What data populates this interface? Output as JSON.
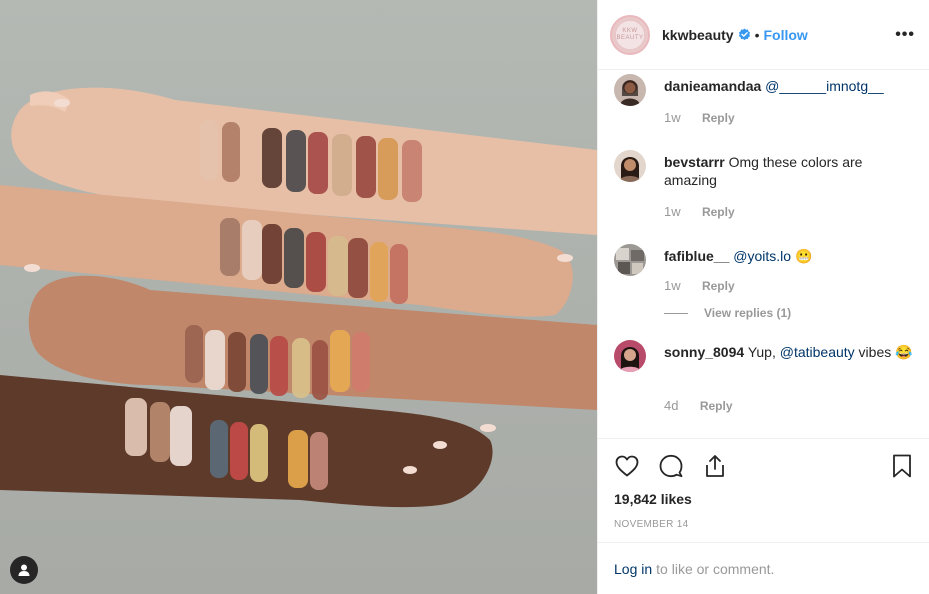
{
  "header": {
    "avatar_text": "KKW BEAUTY",
    "username": "kkwbeauty",
    "separator": "•",
    "follow_label": "Follow",
    "more_label": "•••"
  },
  "comments": [
    {
      "username": "danieamandaa",
      "text": "",
      "mention": "@______imnotg__",
      "suffix": "",
      "time": "1w",
      "reply_label": "Reply"
    },
    {
      "username": "bevstarrr",
      "text": "Omg these colors are amazing",
      "mention": "",
      "suffix": "",
      "time": "1w",
      "reply_label": "Reply"
    },
    {
      "username": "fafiblue__",
      "text": "",
      "mention": "@yoits.lo",
      "suffix": "😬",
      "time": "1w",
      "reply_label": "Reply",
      "view_replies": "View replies (1)"
    },
    {
      "username": "sonny_8094",
      "text": "Yup,",
      "mention": "@tatibeauty",
      "suffix": "vibes 😂",
      "time": "4d",
      "reply_label": "Reply"
    }
  ],
  "actions": {
    "likes": "19,842 likes",
    "date": "NOVEMBER 14"
  },
  "login_bar": {
    "link": "Log in",
    "rest": "to like or comment."
  },
  "colors": {
    "link_blue": "#3897f0",
    "mention_blue": "#003569",
    "muted": "#999999",
    "border": "#efefef"
  },
  "icons": [
    "user-tag-icon",
    "verified-badge-icon",
    "more-options-icon",
    "heart-icon",
    "comment-icon",
    "share-icon",
    "bookmark-icon"
  ]
}
